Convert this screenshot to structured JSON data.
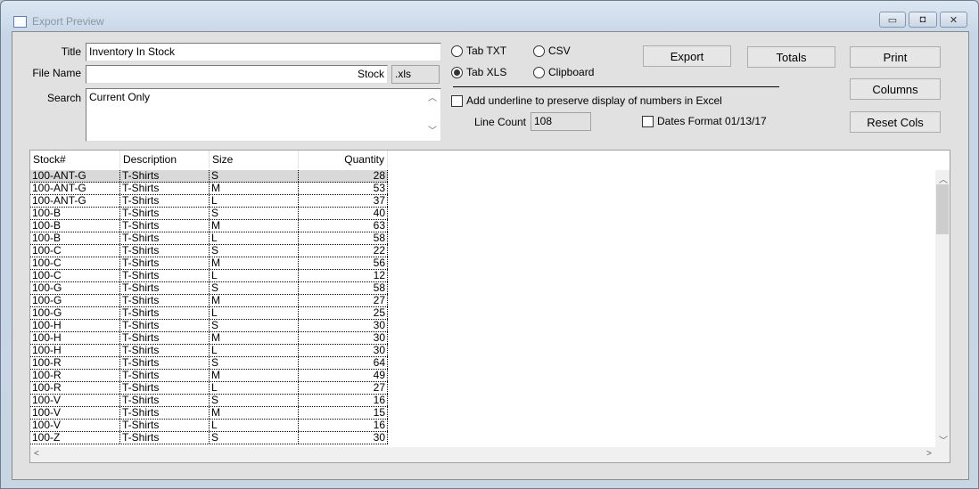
{
  "window": {
    "title": "Export Preview",
    "controls": [
      "minimize",
      "maximize",
      "close"
    ]
  },
  "form": {
    "title_label": "Title",
    "title_value": "Inventory In Stock",
    "filename_label": "File Name",
    "filename_value": "Stock",
    "extension": ".xls",
    "search_label": "Search",
    "search_value": "Current Only"
  },
  "formats": {
    "tab_txt": "Tab TXT",
    "csv": "CSV",
    "tab_xls": "Tab XLS",
    "clipboard": "Clipboard",
    "selected": "Tab XLS"
  },
  "options": {
    "underline_label": "Add underline to preserve display of numbers in Excel",
    "underline_checked": false,
    "line_count_label": "Line Count",
    "line_count": "108",
    "dates_label": "Dates Format 01/13/17",
    "dates_checked": false
  },
  "buttons": {
    "export": "Export",
    "totals": "Totals",
    "print": "Print",
    "columns": "Columns",
    "reset_cols": "Reset Cols"
  },
  "table": {
    "columns": [
      "Stock#",
      "Description",
      "Size",
      "Quantity"
    ],
    "rows": [
      [
        "100-ANT-G",
        "T-Shirts",
        "S",
        "28"
      ],
      [
        "100-ANT-G",
        "T-Shirts",
        "M",
        "53"
      ],
      [
        "100-ANT-G",
        "T-Shirts",
        "L",
        "37"
      ],
      [
        "100-B",
        "T-Shirts",
        "S",
        "40"
      ],
      [
        "100-B",
        "T-Shirts",
        "M",
        "63"
      ],
      [
        "100-B",
        "T-Shirts",
        "L",
        "58"
      ],
      [
        "100-C",
        "T-Shirts",
        "S",
        "22"
      ],
      [
        "100-C",
        "T-Shirts",
        "M",
        "56"
      ],
      [
        "100-C",
        "T-Shirts",
        "L",
        "12"
      ],
      [
        "100-G",
        "T-Shirts",
        "S",
        "58"
      ],
      [
        "100-G",
        "T-Shirts",
        "M",
        "27"
      ],
      [
        "100-G",
        "T-Shirts",
        "L",
        "25"
      ],
      [
        "100-H",
        "T-Shirts",
        "S",
        "30"
      ],
      [
        "100-H",
        "T-Shirts",
        "M",
        "30"
      ],
      [
        "100-H",
        "T-Shirts",
        "L",
        "30"
      ],
      [
        "100-R",
        "T-Shirts",
        "S",
        "64"
      ],
      [
        "100-R",
        "T-Shirts",
        "M",
        "49"
      ],
      [
        "100-R",
        "T-Shirts",
        "L",
        "27"
      ],
      [
        "100-V",
        "T-Shirts",
        "S",
        "16"
      ],
      [
        "100-V",
        "T-Shirts",
        "M",
        "15"
      ],
      [
        "100-V",
        "T-Shirts",
        "L",
        "16"
      ],
      [
        "100-Z",
        "T-Shirts",
        "S",
        "30"
      ]
    ],
    "selected_row": 0
  }
}
